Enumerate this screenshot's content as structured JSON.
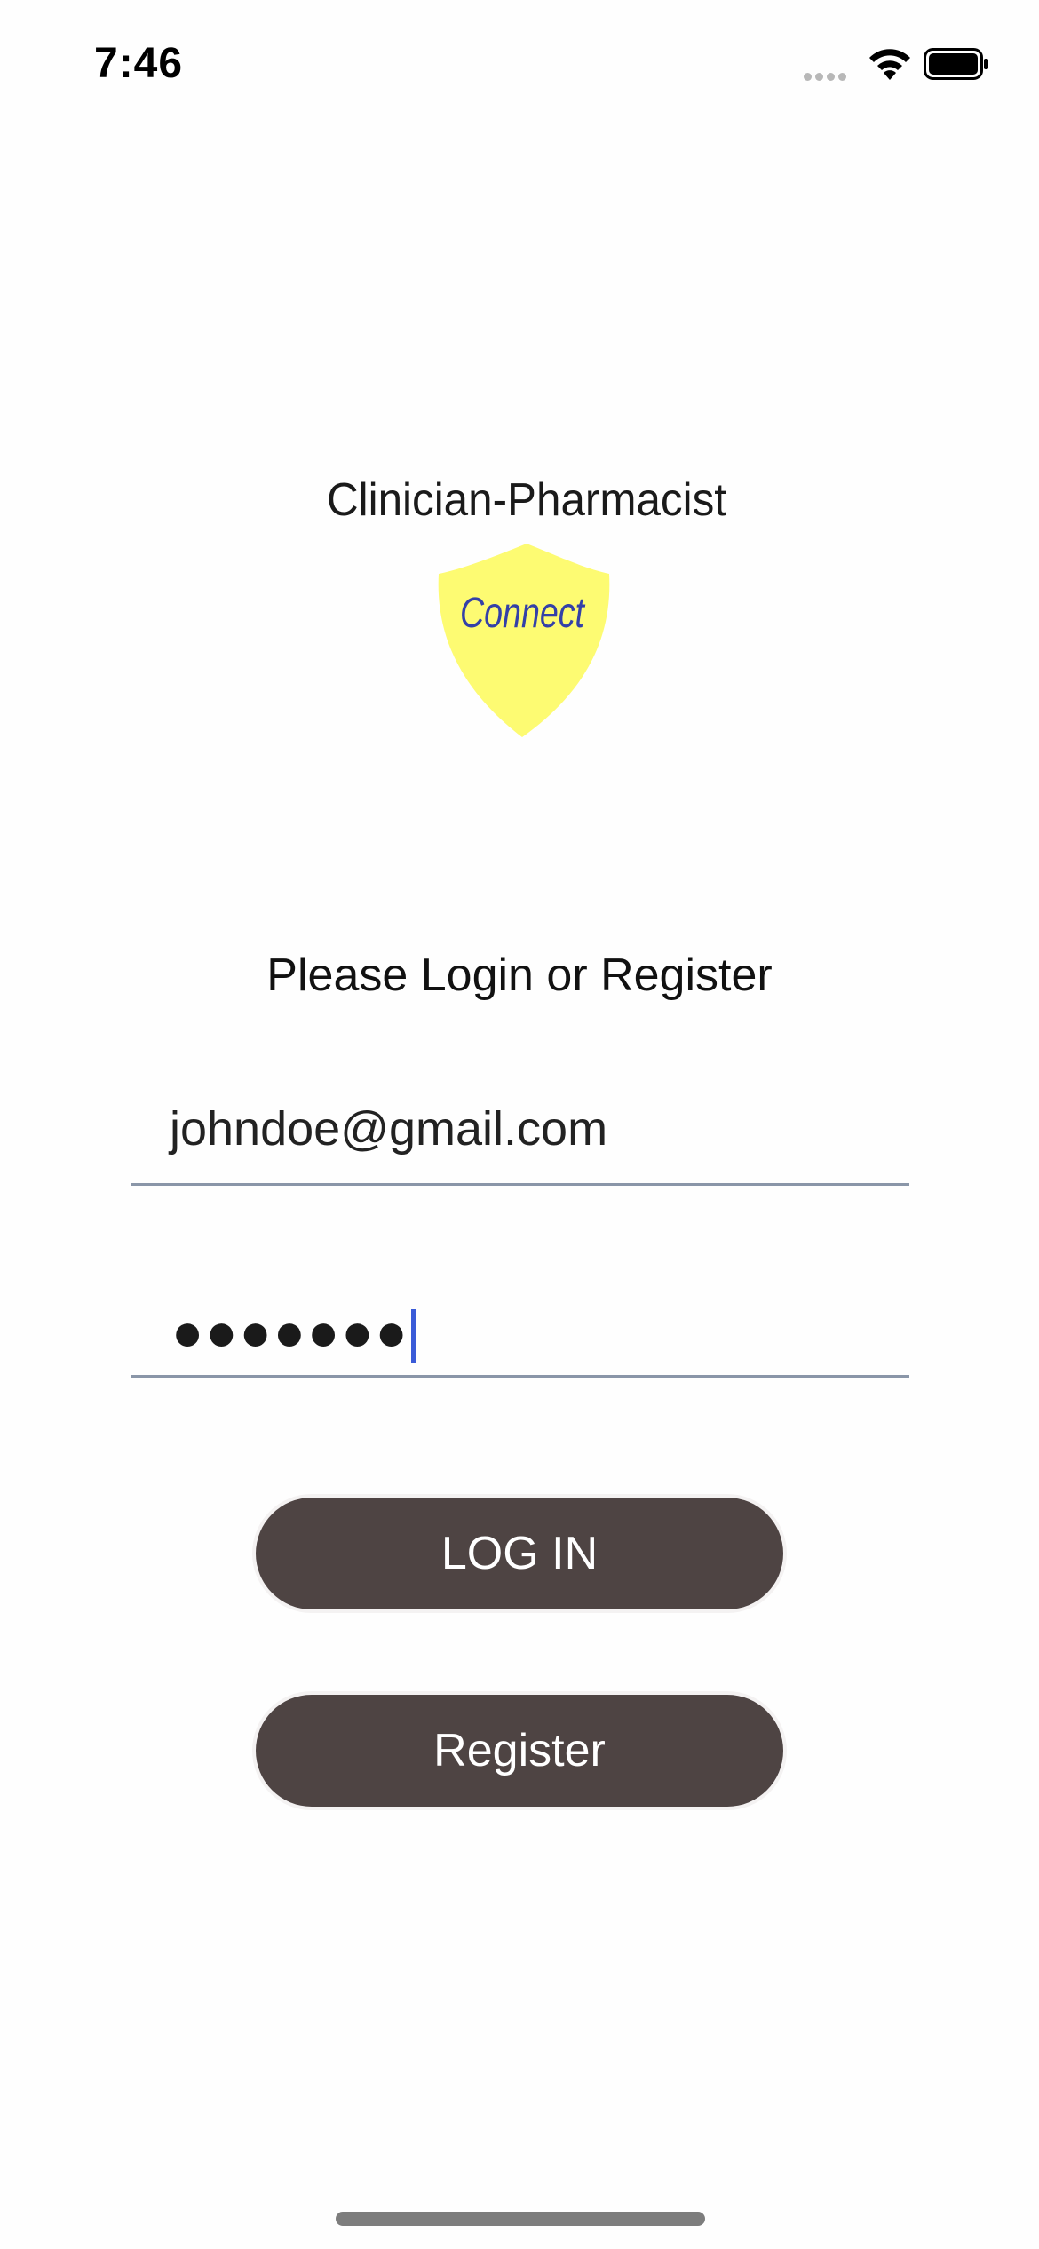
{
  "status_bar": {
    "time": "7:46",
    "signal_icon": "signal-dots-icon",
    "wifi_icon": "wifi-icon",
    "battery_icon": "battery-full-icon"
  },
  "logo": {
    "title": "Clinician-Pharmacist",
    "badge_text": "Connect",
    "badge_color": "#fdfb72",
    "badge_text_color": "#3340a8"
  },
  "login": {
    "prompt": "Please Login or Register",
    "email_value": "johndoe@gmail.com",
    "password_dots": "●●●●●●●"
  },
  "buttons": {
    "login_label": "LOG IN",
    "register_label": "Register",
    "button_color": "#4e4443"
  }
}
